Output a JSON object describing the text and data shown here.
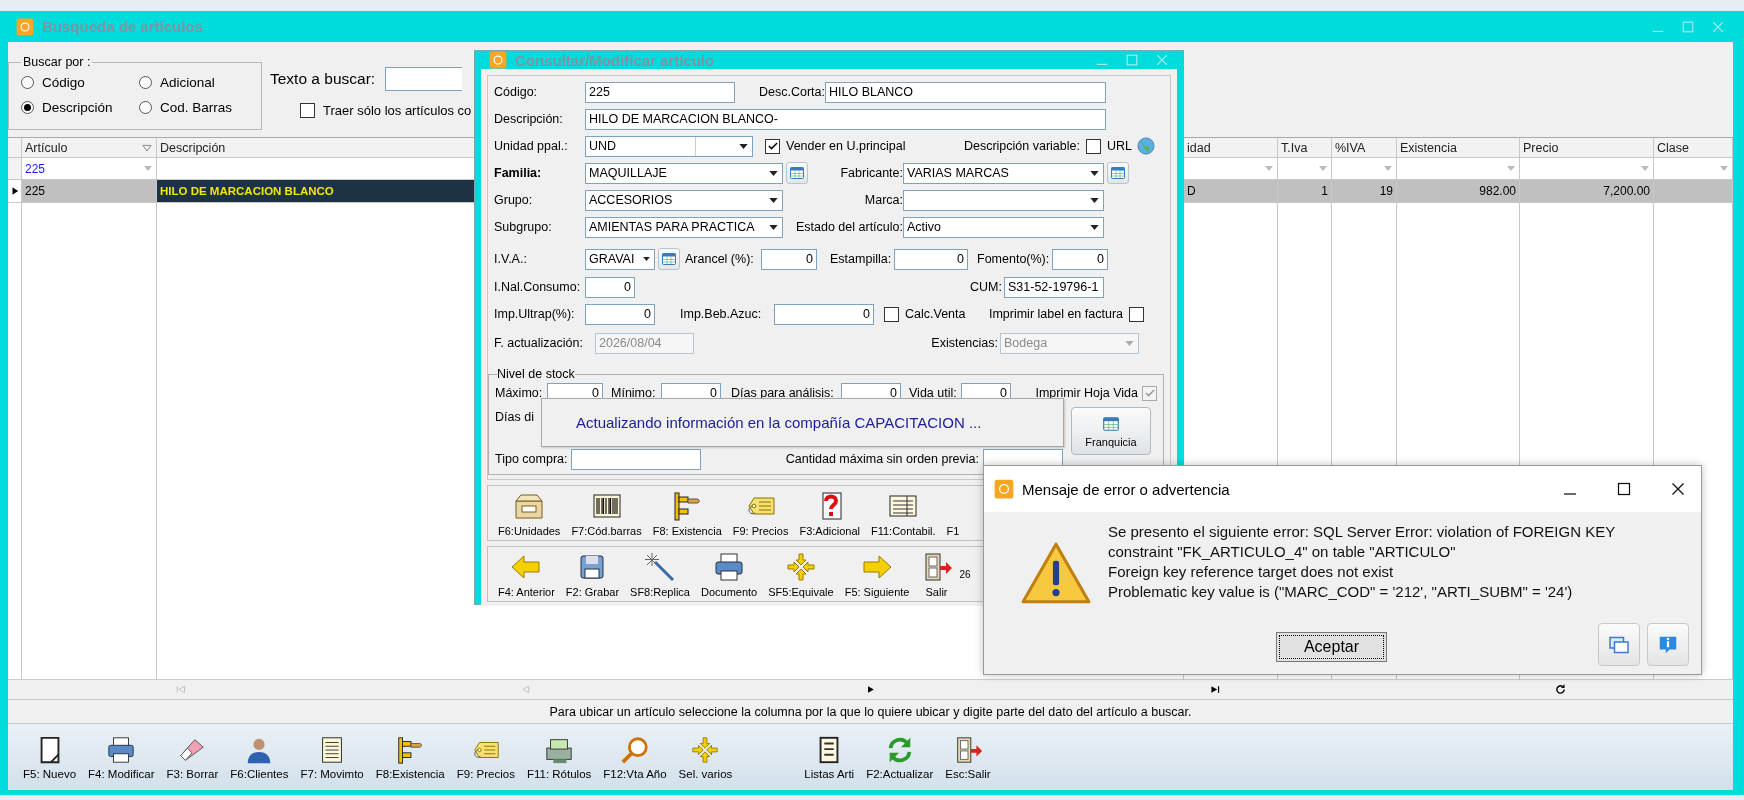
{
  "main_window": {
    "title": "Busqueda de artículos",
    "search": {
      "group_label": "Buscar por :",
      "options": [
        {
          "label": "Código",
          "selected": false
        },
        {
          "label": "Adicional",
          "selected": false
        },
        {
          "label": "Descripción",
          "selected": true
        },
        {
          "label": "Cod. Barras",
          "selected": false
        }
      ],
      "text_label": "Texto a buscar:",
      "only_checkbox": {
        "label": "Traer sólo los artículos co",
        "checked": false
      }
    },
    "table": {
      "columns": [
        {
          "label": "Artículo",
          "filter": "225",
          "sort_icon": true
        },
        {
          "label": "Descripción"
        },
        {
          "label": "idad"
        },
        {
          "label": "T.Iva"
        },
        {
          "label": "%IVA"
        },
        {
          "label": "Existencia"
        },
        {
          "label": "Precio"
        },
        {
          "label": "Clase"
        }
      ],
      "rows": [
        {
          "selected": true,
          "cells": [
            "225",
            "HILO DE MARCACION BLANCO",
            "D",
            "1",
            "19",
            "982.00",
            "7,200.00"
          ]
        }
      ]
    },
    "navigator": [
      {
        "kind": "first",
        "disabled": true
      },
      {
        "kind": "prev",
        "disabled": true
      },
      {
        "kind": "next",
        "disabled": false
      },
      {
        "kind": "last",
        "disabled": false
      },
      {
        "kind": "refresh",
        "disabled": false
      }
    ],
    "status_bar": "Para ubicar un artículo seleccione la columna por la que lo quiere ubicar y digite parte del dato del artículo a buscar.",
    "toolbar": [
      [
        {
          "label": "F5: Nuevo",
          "kind": "newdoc"
        },
        {
          "label": "F4: Modificar",
          "kind": "printer"
        },
        {
          "label": "F3: Borrar",
          "kind": "eraser"
        },
        {
          "label": "F6:Clientes",
          "kind": "person"
        },
        {
          "label": "F7: Movimto",
          "kind": "notepad"
        },
        {
          "label": "F8:Existencia",
          "kind": "shelf"
        },
        {
          "label": "F9: Precios",
          "kind": "tag"
        },
        {
          "label": "F11: Rótulos",
          "kind": "cash"
        },
        {
          "label": "F12:Vta Año",
          "kind": "magnifier"
        },
        {
          "label": "Sel. varios",
          "kind": "arrows"
        }
      ],
      [
        {
          "label": "Listas Arti",
          "kind": "list"
        },
        {
          "label": "F2:Actualizar",
          "kind": "refresh"
        },
        {
          "label": "Esc:Salir",
          "kind": "door"
        }
      ]
    ]
  },
  "article_dialog": {
    "title": "Consultar/Modificar artículo",
    "fields": {
      "codigo": {
        "label": "Código:",
        "value": "225"
      },
      "desc_corta": {
        "label": "Desc.Corta:",
        "value": "HILO BLANCO"
      },
      "descripcion": {
        "label": "Descripción:",
        "value": "HILO DE MARCACION BLANCO-"
      },
      "unidad_ppal": {
        "label": "Unidad ppal.:",
        "value": "UND"
      },
      "vender_u_principal": {
        "label": "Vender en U.principal",
        "checked": true
      },
      "descripcion_variable": {
        "label": "Descripción variable:",
        "checked": false
      },
      "url": {
        "label": "URL"
      },
      "familia": {
        "label": "Familia:",
        "value": "MAQUILLAJE"
      },
      "fabricante": {
        "label": "Fabricante:",
        "value": "VARIAS MARCAS"
      },
      "grupo": {
        "label": "Grupo:",
        "value": "ACCESORIOS"
      },
      "marca": {
        "label": "Marca:"
      },
      "subgrupo": {
        "label": "Subgrupo:",
        "value": "AMIENTAS PARA PRACTICA"
      },
      "estado": {
        "label": "Estado del artículo:",
        "value": "Activo"
      },
      "iva": {
        "label": "I.V.A.:",
        "value": "GRAVAI"
      },
      "arancel": {
        "label": "Arancel (%):",
        "value": "0"
      },
      "estampilla": {
        "label": "Estampilla:",
        "value": "0"
      },
      "fomento": {
        "label": "Fomento(%):",
        "value": "0"
      },
      "i_nal_consumo": {
        "label": "I.Nal.Consumo:",
        "value": "0"
      },
      "cum": {
        "label": "CUM:",
        "value": "S31-52-19796-1"
      },
      "imp_ultrap": {
        "label": "Imp.Ultrap(%):",
        "value": "0"
      },
      "imp_beb_azuc": {
        "label": "Imp.Beb.Azuc:",
        "value": "0"
      },
      "calc_venta": {
        "label": "Calc.Venta",
        "checked": false
      },
      "imprimir_label": {
        "label": "Imprimir label en factura",
        "checked": false
      },
      "f_actualizacion": {
        "label": "F. actualización:",
        "value": "2026/08/04",
        "disabled": true
      },
      "existencias": {
        "label": "Existencias:",
        "value": "Bodega",
        "disabled": true
      }
    },
    "stock": {
      "title": "Nivel de stock",
      "maximo": {
        "label": "Máximo:",
        "value": "0"
      },
      "minimo": {
        "label": "Mínimo:",
        "value": "0"
      },
      "dias_analisis": {
        "label": "Días para análisis:",
        "value": "0"
      },
      "vida_util": {
        "label": "Vida util:",
        "value": "0"
      },
      "imprimir_hoja_vida": {
        "label": "Imprimir Hoja Vida",
        "checked": true,
        "disabled": true
      },
      "dias_di": {
        "label": "Días di"
      },
      "tipo_compra": {
        "label": "Tipo compra:"
      },
      "cantidad_maxima": {
        "label": "Cantidad máxima sin orden previa:"
      },
      "franquicia_button": "Franquicia"
    },
    "toolbar_1": [
      {
        "label": "F6:Unidades",
        "kind": "box"
      },
      {
        "label": "F7:Cód.barras",
        "kind": "barcode"
      },
      {
        "label": "F8: Existencia",
        "kind": "shelf"
      },
      {
        "label": "F9: Precios",
        "kind": "tag"
      },
      {
        "label": "F3:Adicional",
        "kind": "help"
      },
      {
        "label": "F11:Contabil.",
        "kind": "ledger"
      },
      {
        "label": "F1",
        "kind": "none"
      }
    ],
    "toolbar_2": [
      {
        "label": "F4: Anterior",
        "kind": "left"
      },
      {
        "label": "F2: Grabar",
        "kind": "disk"
      },
      {
        "label": "SF8:Replica",
        "kind": "wand"
      },
      {
        "label": "Documento",
        "kind": "printer"
      },
      {
        "label": "SF5:Equivale",
        "kind": "arrows"
      },
      {
        "label": "F5: Siguiente",
        "kind": "right"
      },
      {
        "label": "Salir",
        "kind": "door"
      }
    ],
    "toolbar_2_tail": "26"
  },
  "progress_note": "Actualizando información en la compañía CAPACITACION ...",
  "error_dialog": {
    "title": "Mensaje de error o advertencia",
    "message": [
      "Se presento el siguiente error: SQL Server Error: violation of FOREIGN KEY constraint \"FK_ARTICULO_4\" on table \"ARTICULO\"",
      "Foreign key reference target does not exist",
      "Problematic key value is (\"MARC_COD\" = '212', \"ARTI_SUBM\" = '24')"
    ],
    "ok_button": "Aceptar"
  }
}
